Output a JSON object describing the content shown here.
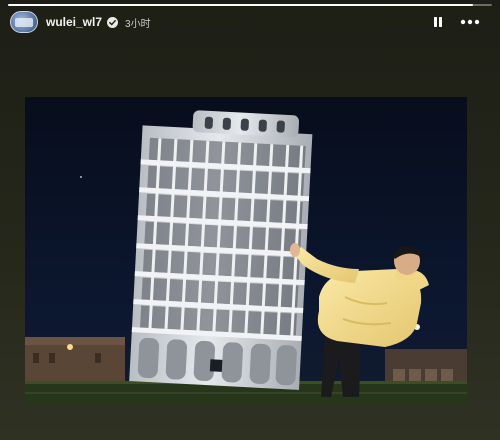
{
  "story": {
    "progress": 0.96,
    "username": "wulei_wl7",
    "time_ago": "3小时",
    "verified": true
  },
  "icons": {
    "avatar": "avatar-image",
    "verified": "verified-badge-icon",
    "pause": "pause-icon",
    "more": "more-options-icon"
  },
  "photo": {
    "subject": "leaning-tower-photo"
  },
  "colors": {
    "background": "#25271b",
    "text": "#ffffff",
    "secondary_text": "#cfcfcf",
    "jacket": "#f3dd8e",
    "tower_stone": "#d9dde0"
  }
}
